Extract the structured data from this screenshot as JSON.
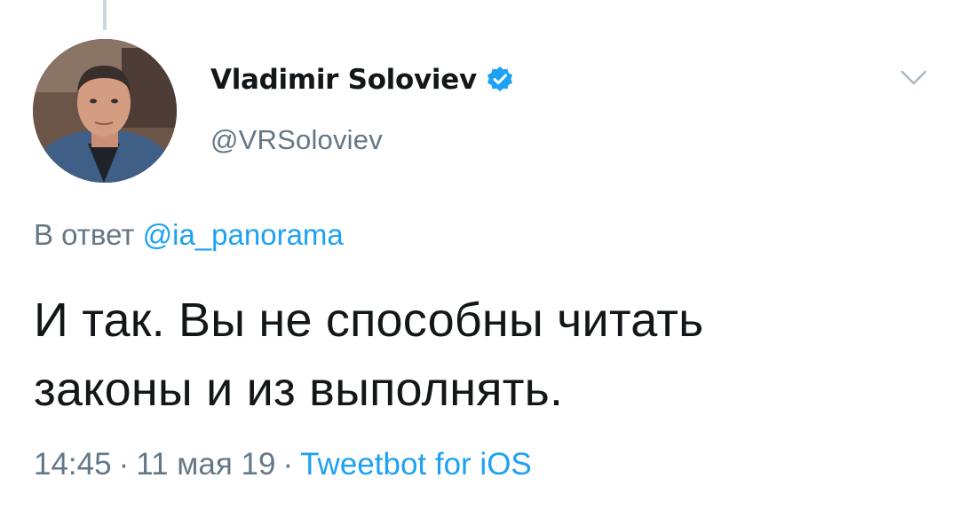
{
  "tweet": {
    "author": {
      "display_name": "Vladimir Soloviev",
      "handle": "@VRSoloviev",
      "verified": true
    },
    "reply": {
      "prefix": "В ответ",
      "mention": "@ia_panorama"
    },
    "text_line1": "И так. Вы не способны читать",
    "text_line2": "законы и из выполнять.",
    "meta": {
      "time": "14:45",
      "separator": "·",
      "date": "11 мая 19",
      "source": "Tweetbot for iOS"
    }
  },
  "colors": {
    "link": "#1da1f2",
    "secondary": "#657786",
    "primary_text": "#14171a",
    "thread_line": "#ccd6dd"
  },
  "icons": {
    "verified": "verified-badge-icon",
    "menu": "chevron-down-icon"
  }
}
